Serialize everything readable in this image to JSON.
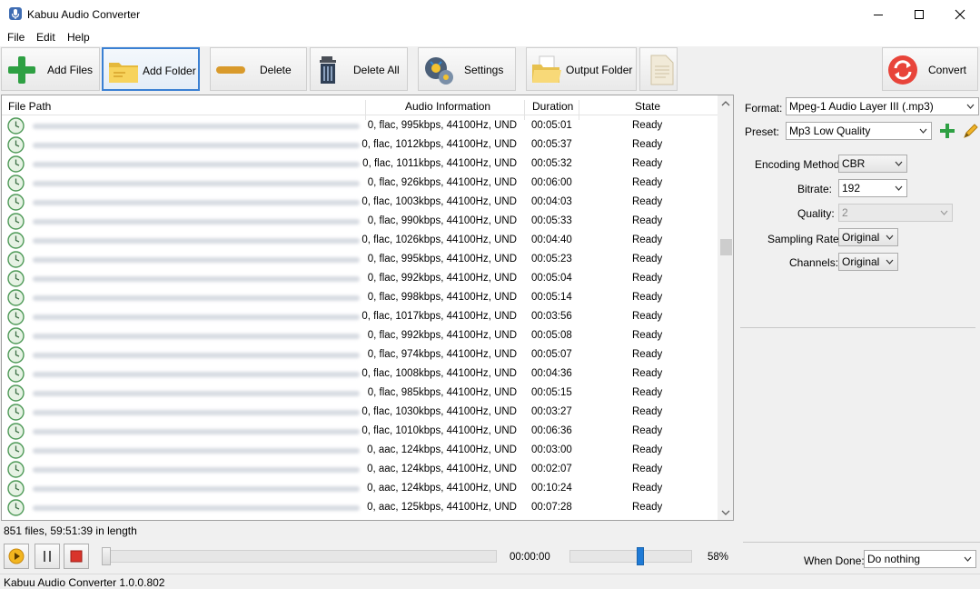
{
  "window": {
    "title": "Kabuu Audio Converter"
  },
  "menu": [
    "File",
    "Edit",
    "Help"
  ],
  "toolbar": {
    "add_files": "Add Files",
    "add_folder": "Add Folder",
    "delete": "Delete",
    "delete_all": "Delete All",
    "settings": "Settings",
    "output_folder": "Output Folder",
    "convert": "Convert"
  },
  "list": {
    "headers": {
      "path": "File Path",
      "info": "Audio Information",
      "duration": "Duration",
      "state": "State"
    },
    "rows": [
      {
        "info": "0, flac, 995kbps, 44100Hz, UND",
        "duration": "00:05:01",
        "state": "Ready"
      },
      {
        "info": "0, flac, 1012kbps, 44100Hz, UND",
        "duration": "00:05:37",
        "state": "Ready"
      },
      {
        "info": "0, flac, 1011kbps, 44100Hz, UND",
        "duration": "00:05:32",
        "state": "Ready"
      },
      {
        "info": "0, flac, 926kbps, 44100Hz, UND",
        "duration": "00:06:00",
        "state": "Ready"
      },
      {
        "info": "0, flac, 1003kbps, 44100Hz, UND",
        "duration": "00:04:03",
        "state": "Ready"
      },
      {
        "info": "0, flac, 990kbps, 44100Hz, UND",
        "duration": "00:05:33",
        "state": "Ready"
      },
      {
        "info": "0, flac, 1026kbps, 44100Hz, UND",
        "duration": "00:04:40",
        "state": "Ready"
      },
      {
        "info": "0, flac, 995kbps, 44100Hz, UND",
        "duration": "00:05:23",
        "state": "Ready"
      },
      {
        "info": "0, flac, 992kbps, 44100Hz, UND",
        "duration": "00:05:04",
        "state": "Ready"
      },
      {
        "info": "0, flac, 998kbps, 44100Hz, UND",
        "duration": "00:05:14",
        "state": "Ready"
      },
      {
        "info": "0, flac, 1017kbps, 44100Hz, UND",
        "duration": "00:03:56",
        "state": "Ready"
      },
      {
        "info": "0, flac, 992kbps, 44100Hz, UND",
        "duration": "00:05:08",
        "state": "Ready"
      },
      {
        "info": "0, flac, 974kbps, 44100Hz, UND",
        "duration": "00:05:07",
        "state": "Ready"
      },
      {
        "info": "0, flac, 1008kbps, 44100Hz, UND",
        "duration": "00:04:36",
        "state": "Ready"
      },
      {
        "info": "0, flac, 985kbps, 44100Hz, UND",
        "duration": "00:05:15",
        "state": "Ready"
      },
      {
        "info": "0, flac, 1030kbps, 44100Hz, UND",
        "duration": "00:03:27",
        "state": "Ready"
      },
      {
        "info": "0, flac, 1010kbps, 44100Hz, UND",
        "duration": "00:06:36",
        "state": "Ready"
      },
      {
        "info": "0, aac, 124kbps, 44100Hz, UND",
        "duration": "00:03:00",
        "state": "Ready"
      },
      {
        "info": "0, aac, 124kbps, 44100Hz, UND",
        "duration": "00:02:07",
        "state": "Ready"
      },
      {
        "info": "0, aac, 124kbps, 44100Hz, UND",
        "duration": "00:10:24",
        "state": "Ready"
      },
      {
        "info": "0, aac, 125kbps, 44100Hz, UND",
        "duration": "00:07:28",
        "state": "Ready"
      }
    ]
  },
  "status": {
    "summary": "851 files, 59:51:39 in length"
  },
  "player": {
    "time": "00:00:00",
    "volume_label": "58%",
    "volume_level": 0.58,
    "progress_level": 0
  },
  "settings": {
    "format_label": "Format:",
    "format_value": "Mpeg-1 Audio Layer III (.mp3)",
    "preset_label": "Preset:",
    "preset_value": "Mp3 Low Quality",
    "encoding_label": "Encoding Method:",
    "encoding_value": "CBR",
    "bitrate_label": "Bitrate:",
    "bitrate_value": "192",
    "quality_label": "Quality:",
    "quality_value": "2",
    "sampling_label": "Sampling Rate:",
    "sampling_value": "Original",
    "channels_label": "Channels:",
    "channels_value": "Original",
    "when_done_label": "When Done:",
    "when_done_value": "Do nothing"
  },
  "footer": {
    "version": "Kabuu Audio Converter 1.0.0.802"
  },
  "icons": {
    "row": "clock-icon",
    "add_files": "plus-icon",
    "add_folder": "folder-icon",
    "delete": "minus-icon",
    "delete_all": "trash-icon",
    "settings": "gear-icon",
    "output_folder": "open-folder-icon",
    "convert": "convert-icon"
  },
  "colors": {
    "accent": "#3a80d3",
    "convert": "#e8443a",
    "add": "#2ea043",
    "volume": "#1e7ad6"
  }
}
